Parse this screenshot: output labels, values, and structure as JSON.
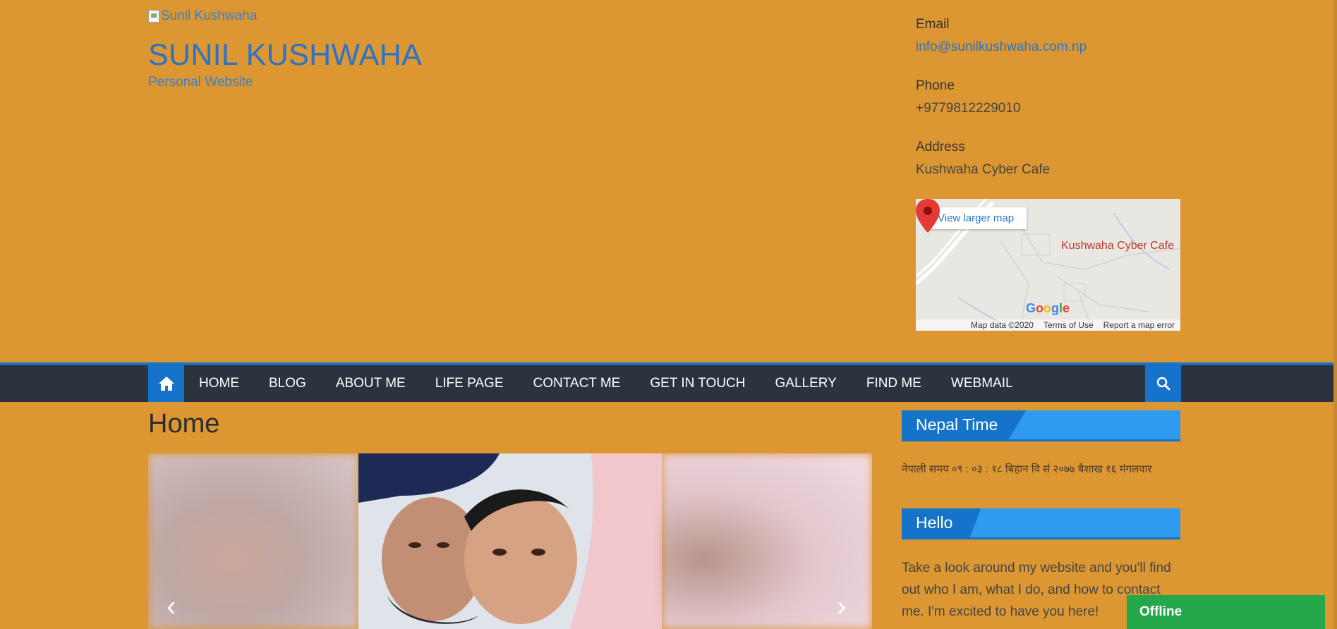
{
  "header": {
    "logo_alt": "Sunil Kushwaha",
    "site_title": "SUNIL KUSHWAHA",
    "tagline": "Personal Website"
  },
  "contact": {
    "email_label": "Email",
    "email_value": "info@sunilkushwaha.com.np",
    "phone_label": "Phone",
    "phone_value": "+9779812229010",
    "address_label": "Address",
    "address_value": "Kushwaha Cyber Cafe"
  },
  "map": {
    "view_larger": "View larger map",
    "place_label": "Kushwaha Cyber Cafe",
    "google_logo": "Google",
    "map_data": "Map data ©2020",
    "terms": "Terms of Use",
    "report": "Report a map error"
  },
  "nav": {
    "items": [
      "HOME",
      "BLOG",
      "ABOUT ME",
      "LIFE PAGE",
      "CONTACT ME",
      "GET IN TOUCH",
      "GALLERY",
      "FIND ME",
      "WEBMAIL"
    ],
    "icons": {
      "home": "home-icon",
      "search": "search-icon"
    }
  },
  "main": {
    "page_title": "Home",
    "slider_prev": "‹",
    "slider_next": "›"
  },
  "sidebar": {
    "nepal_time_title": "Nepal Time",
    "nepal_time_text": "नेपाली समय ०९ : ०३ : १८ बिहान     वि सं २०७७ बैशाख १६ मंगलवार",
    "hello_title": "Hello",
    "hello_text": "Take a look around my website and you'll find out who I am, what I do, and how to contact me. I'm excited to have you here!"
  },
  "chat": {
    "status": "Offline"
  },
  "colors": {
    "background": "#dc9732",
    "brand_blue": "#1574c9",
    "navbar": "#2b333f",
    "offline_green": "#23a84a"
  }
}
